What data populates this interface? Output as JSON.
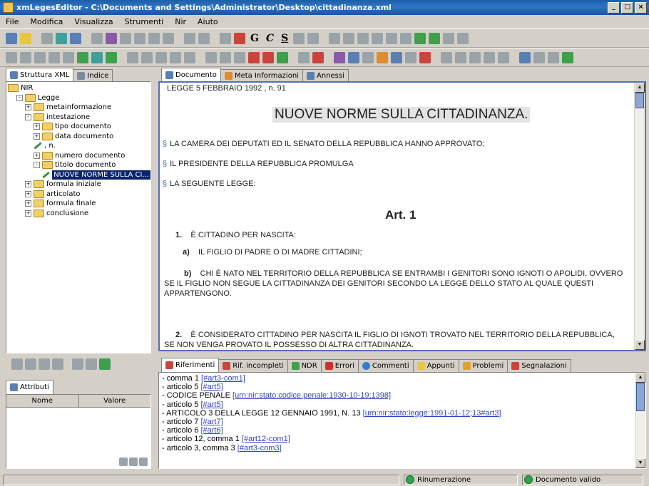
{
  "window": {
    "title": "xmLegesEditor - C:\\Documents and Settings\\Administrator\\Desktop\\cittadinanza.xml",
    "minimize": "_",
    "maximize": "□",
    "close": "×"
  },
  "menu": {
    "items": [
      "File",
      "Modifica",
      "Visualizza",
      "Strumenti",
      "Nir",
      "Aiuto"
    ]
  },
  "toolbar2": {
    "g": "G",
    "c": "C",
    "s": "S"
  },
  "left_panel": {
    "tabs": [
      "Struttura XML",
      "Indice"
    ],
    "tree": [
      {
        "label": "NIR",
        "depth": 0,
        "type": "folder"
      },
      {
        "label": "Legge",
        "depth": 1,
        "type": "folder",
        "exp": "-"
      },
      {
        "label": "metainformazione",
        "depth": 2,
        "type": "folder",
        "exp": "+"
      },
      {
        "label": "intestazione",
        "depth": 2,
        "type": "folder",
        "exp": "-"
      },
      {
        "label": "tipo documento",
        "depth": 3,
        "type": "folder",
        "exp": "+"
      },
      {
        "label": "data documento",
        "depth": 3,
        "type": "folder",
        "exp": "+"
      },
      {
        "label": ", n.",
        "depth": 3,
        "type": "text"
      },
      {
        "label": "numero documento",
        "depth": 3,
        "type": "folder",
        "exp": "+"
      },
      {
        "label": "titolo documento",
        "depth": 3,
        "type": "folder",
        "exp": "-"
      },
      {
        "label": "NUOVE NORME SULLA CI...",
        "depth": 4,
        "type": "text",
        "selected": true
      },
      {
        "label": "formula iniziale",
        "depth": 2,
        "type": "folder",
        "exp": "+"
      },
      {
        "label": "articolato",
        "depth": 2,
        "type": "folder",
        "exp": "+"
      },
      {
        "label": "formula finale",
        "depth": 2,
        "type": "folder",
        "exp": "+"
      },
      {
        "label": "conclusione",
        "depth": 2,
        "type": "folder",
        "exp": "+"
      }
    ]
  },
  "attributes": {
    "tab": "Attributi",
    "col_name": "Nome",
    "col_value": "Valore"
  },
  "doc_tabs": [
    "Documento",
    "Meta Informazioni",
    "Annessi"
  ],
  "document": {
    "header": "LEGGE   5 FEBBRAIO 1992  , n.   91",
    "title": "NUOVE NORME SULLA CITTADINANZA.",
    "s1": "LA CAMERA DEI DEPUTATI ED IL SENATO DELLA REPUBBLICA HANNO APPROVATO;",
    "s2": "IL PRESIDENTE DELLA REPUBBLICA PROMULGA",
    "s3": "LA SEGUENTE LEGGE:",
    "article": "Art. 1",
    "c1_num": "1.",
    "c1_text": "È CITTADINO PER NASCITA:",
    "la_num": "a)",
    "la_text": "IL FIGLIO DI PADRE O DI MADRE CITTADINI;",
    "lb_num": "b)",
    "lb_text_1": "CHI È NATO NEL TERRITORIO DELLA REPUBBLICA SE ENTRAMBI I GENITORI SONO IGNOTI O APOLIDI, OVVERO",
    "lb_text_2": "SE IL FIGLIO NON SEGUE LA CITTADINANZA DEI GENITORI SECONDO LA LEGGE DELLO STATO AL QUALE QUESTI",
    "lb_text_3": "APPARTENGONO.",
    "c2_num": "2.",
    "c2_text_1": "È CONSIDERATO CITTADINO PER NASCITA IL FIGLIO DI IGNOTI TROVATO NEL TERRITORIO DELLA REPUBBLICA,",
    "c2_text_2": "SE NON VENGA PROVATO IL POSSESSO DI ALTRA CITTADINANZA."
  },
  "bottom_tabs": [
    "Riferimenti",
    "Rif. incompleti",
    "NDR",
    "Errori",
    "Commenti",
    "Appunti",
    "Problemi",
    "Segnalazioni"
  ],
  "references": [
    {
      "text": "comma 1 ",
      "link": "[#art3-com1]"
    },
    {
      "text": "articolo 5 ",
      "link": "[#art5]"
    },
    {
      "text": "CODICE PENALE ",
      "link": "[urn:nir:stato:codice.penale:1930-10-19;1398]"
    },
    {
      "text": "articolo 5 ",
      "link": "[#art5]"
    },
    {
      "text": "ARTICOLO 3 DELLA LEGGE 12 GENNAIO 1991, N. 13 ",
      "link": "[urn:nir:stato:legge:1991-01-12;13#art3]"
    },
    {
      "text": "articolo 7 ",
      "link": "[#art7]"
    },
    {
      "text": "articolo 6 ",
      "link": "[#art6]"
    },
    {
      "text": "articolo 12, comma 1 ",
      "link": "[#art12-com1]"
    },
    {
      "text": "articolo 3, comma 3 ",
      "link": "[#art3-com3]"
    }
  ],
  "status": {
    "renumber": "Rinumerazione",
    "valid": "Documento valido"
  }
}
